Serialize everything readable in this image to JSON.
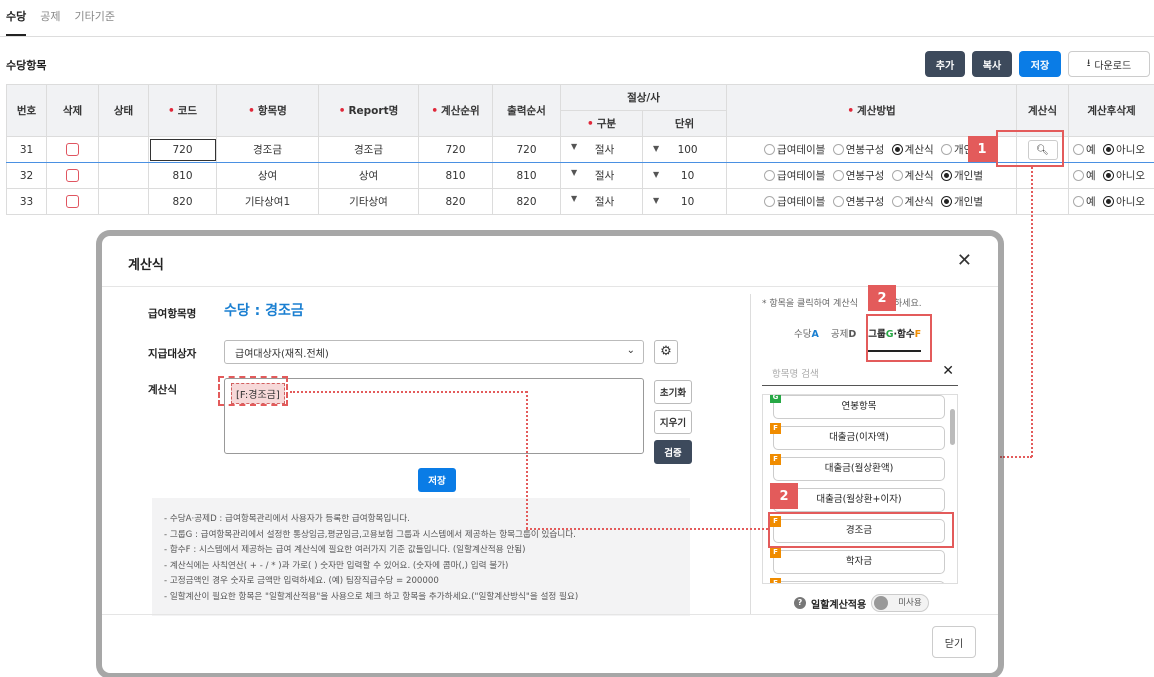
{
  "tabs": [
    "수당",
    "공제",
    "기타기준"
  ],
  "section_title": "수당항목",
  "toolbar": {
    "add": "추가",
    "copy": "복사",
    "save": "저장",
    "download": "다운로드",
    "download_icon": "download-icon"
  },
  "table": {
    "headers": {
      "no": "번호",
      "delete": "삭제",
      "status": "상태",
      "code": "코드",
      "name": "항목명",
      "report": "Report명",
      "calc_order": "계산순위",
      "print_order": "출력순서",
      "rounding": "절상/사",
      "round_type": "구분",
      "round_unit": "단위",
      "method": "계산방법",
      "formula": "계산식",
      "after": "계산후삭제"
    },
    "rows": [
      {
        "no": "31",
        "code": "720",
        "name": "경조금",
        "report": "경조금",
        "calc": "720",
        "print": "720",
        "round": "절사",
        "unit": "100",
        "methods": [
          "급여테이블",
          "연봉구성",
          "계산식",
          "개인별"
        ],
        "method_sel": "계산식",
        "after_yes": "예",
        "after_no": "아니오",
        "after_sel": "아니오"
      },
      {
        "no": "32",
        "code": "810",
        "name": "상여",
        "report": "상여",
        "calc": "810",
        "print": "810",
        "round": "절사",
        "unit": "10",
        "methods": [
          "급여테이블",
          "연봉구성",
          "계산식",
          "개인별"
        ],
        "method_sel": "개인별",
        "after_yes": "예",
        "after_no": "아니오",
        "after_sel": "아니오"
      },
      {
        "no": "33",
        "code": "820",
        "name": "기타상여1",
        "report": "기타상여",
        "calc": "820",
        "print": "820",
        "round": "절사",
        "unit": "10",
        "methods": [
          "급여테이블",
          "연봉구성",
          "계산식",
          "개인별"
        ],
        "method_sel": "개인별",
        "after_yes": "예",
        "after_no": "아니오",
        "after_sel": "아니오"
      }
    ]
  },
  "badges": {
    "one": "1",
    "two": "2"
  },
  "dialog": {
    "title": "계산식",
    "close_icon": "close-icon",
    "item_label": "급여항목명",
    "item_value": "수당 : 경조금",
    "target_label": "지급대상자",
    "target_value": "급여대상자(재직.전체)",
    "formula_label": "계산식",
    "formula_token": "[F:경조금]",
    "btn_reset": "초기화",
    "btn_clear": "지우기",
    "btn_verify": "검증",
    "btn_save": "저장",
    "notes": [
      "- 수당A·공제D : 급여항목관리에서 사용자가 등록한 급여항목입니다.",
      "- 그룹G : 급여항목관리에서 설정한 통상임금,평균임금,고용보험 그룹과 시스템에서 제공하는 항목그룹이 있습니다.",
      "- 함수F : 시스템에서 제공하는 급여 계산식에 필요한 여러가지 기준 값들입니다. (일할계산적용 안됨)",
      "- 계산식에는 사칙연산( + - / * )과 가로( ) 숫자만 입력할 수 있어요. (숫자에 콤마(,) 입력 불가)",
      "- 고정금액인 경우 숫자로 금액만 입력하세요. (예) 팀장직급수당 = 200000",
      "- 일할계산이 필요한 항목은 \"일할계산적용\"을 사용으로 체크 하고 항목을 추가하세요.(\"일할계산방식\"을 설정 필요)"
    ],
    "hint": "* 항목을 클릭하여 계산식에 추가하세요.",
    "hint_visible": "* 항목을 클릭하여 계산식",
    "hint_tail": "하세요.",
    "right_tabs": {
      "a": "수당",
      "a_suffix": "A",
      "d": "공제",
      "d_suffix": "D",
      "g": "그룹",
      "g_suffix": "G",
      "sep": "·",
      "f": "함수",
      "f_suffix": "F"
    },
    "search_placeholder": "항목명 검색",
    "list": [
      {
        "tag": "G",
        "label": "연봉항목"
      },
      {
        "tag": "F",
        "label": "대출금(이자액)"
      },
      {
        "tag": "F",
        "label": "대출금(월상환액)"
      },
      {
        "tag": "F",
        "label": "대출금(월상환+이자)"
      },
      {
        "tag": "F",
        "label": "경조금"
      },
      {
        "tag": "F",
        "label": "학자금"
      },
      {
        "tag": "F",
        "label": ""
      }
    ],
    "daily_label": "일할계산적용",
    "daily_toggle": "미사용",
    "close_button": "닫기"
  }
}
